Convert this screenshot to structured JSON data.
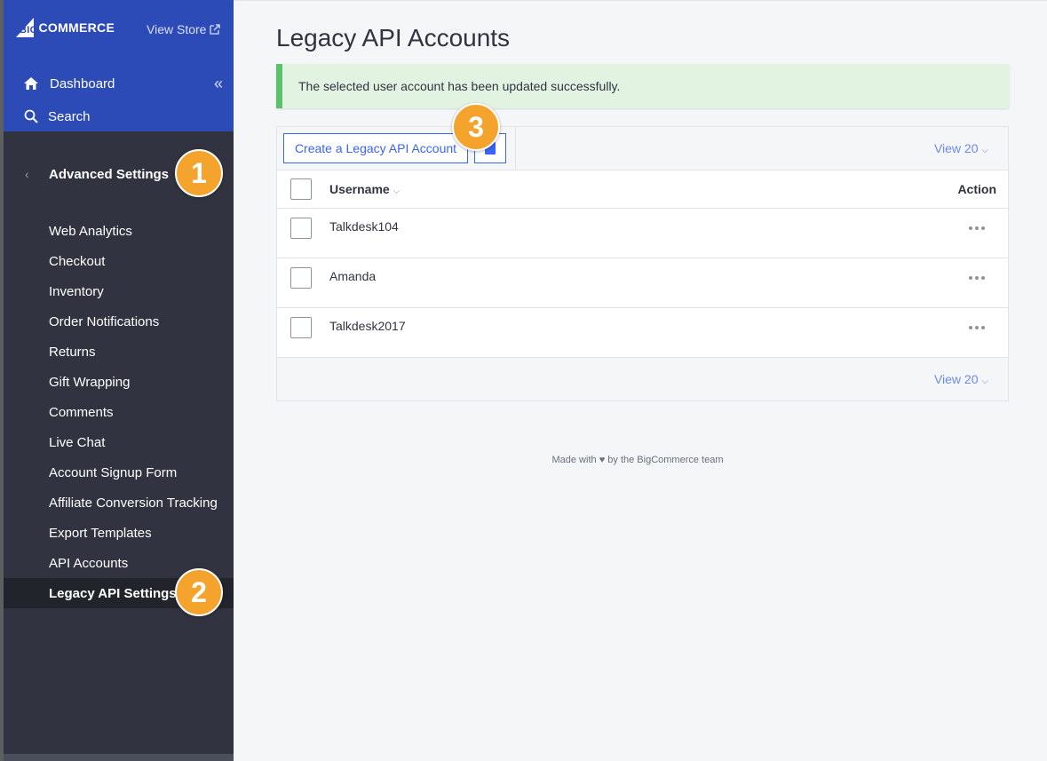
{
  "sidebar": {
    "logo_prefix": "BIG",
    "logo_text": "COMMERCE",
    "view_store": "View Store",
    "dashboard": "Dashboard",
    "search": "Search",
    "section_title": "Advanced Settings",
    "items": [
      {
        "label": "Web Analytics"
      },
      {
        "label": "Checkout"
      },
      {
        "label": "Inventory"
      },
      {
        "label": "Order Notifications"
      },
      {
        "label": "Returns"
      },
      {
        "label": "Gift Wrapping"
      },
      {
        "label": "Comments"
      },
      {
        "label": "Live Chat"
      },
      {
        "label": "Account Signup Form"
      },
      {
        "label": "Affiliate Conversion Tracking"
      },
      {
        "label": "Export Templates"
      },
      {
        "label": "API Accounts"
      },
      {
        "label": "Legacy API Settings",
        "active": true
      }
    ]
  },
  "badges": [
    "1",
    "2",
    "3"
  ],
  "main": {
    "title": "Legacy API Accounts",
    "alert": "The selected user account has been updated successfully.",
    "create_button": "Create a Legacy API Account",
    "view_top": "View 20",
    "view_bottom": "View 20",
    "columns": {
      "username": "Username",
      "action": "Action"
    },
    "rows": [
      {
        "username": "Talkdesk104"
      },
      {
        "username": "Amanda"
      },
      {
        "username": "Talkdesk2017"
      }
    ],
    "footer_prefix": "Made with",
    "footer_suffix": "by the BigCommerce team"
  },
  "colors": {
    "sidebar_bg": "#313440",
    "sidebar_top": "#2d4bb6",
    "accent": "#3c64f4",
    "success": "#5cc26a",
    "badge": "#f4a42c"
  }
}
